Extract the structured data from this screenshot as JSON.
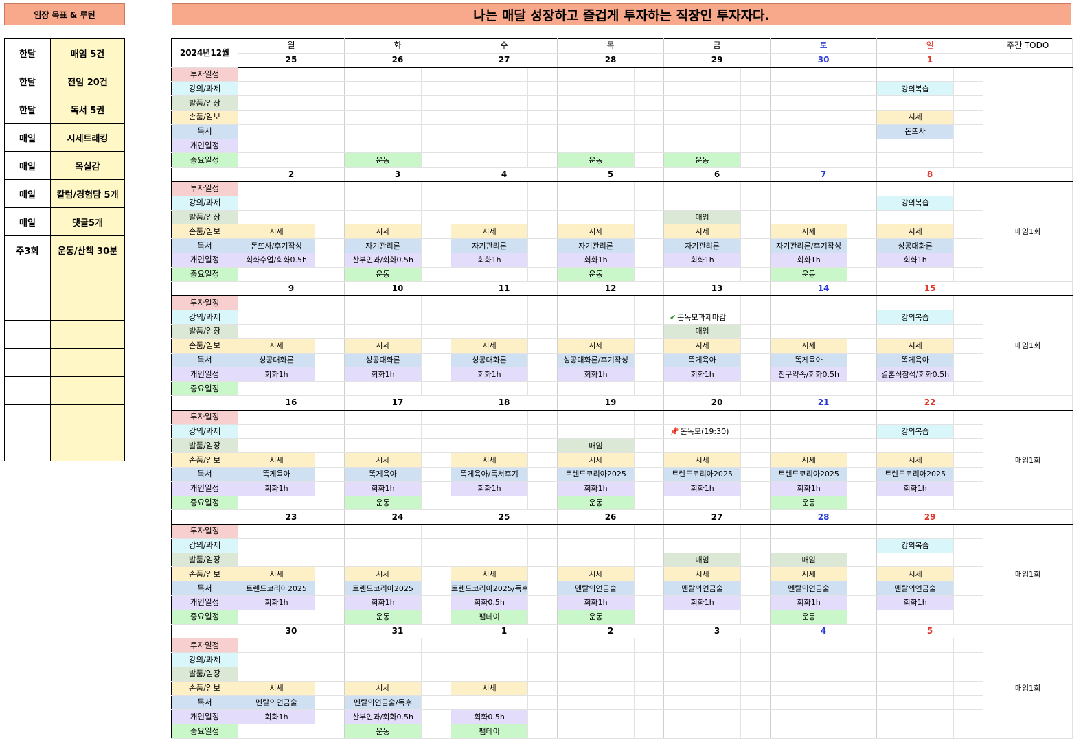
{
  "left_title": "임장 목표 & 루틴",
  "main_title": "나는 매달 성장하고 즐겁게 투자하는 직장인 투자자다.",
  "goals": [
    {
      "freq": "한달",
      "goal": "매임 5건"
    },
    {
      "freq": "한달",
      "goal": "전임 20건"
    },
    {
      "freq": "한달",
      "goal": "독서 5권"
    },
    {
      "freq": "매일",
      "goal": "시세트래킹"
    },
    {
      "freq": "매일",
      "goal": "목실감"
    },
    {
      "freq": "매일",
      "goal": "칼럼/경험담 5개"
    },
    {
      "freq": "매일",
      "goal": "댓글5개"
    },
    {
      "freq": "주3회",
      "goal": "운동/산책 30분"
    },
    {
      "freq": "",
      "goal": ""
    },
    {
      "freq": "",
      "goal": ""
    },
    {
      "freq": "",
      "goal": ""
    },
    {
      "freq": "",
      "goal": ""
    },
    {
      "freq": "",
      "goal": ""
    },
    {
      "freq": "",
      "goal": ""
    },
    {
      "freq": "",
      "goal": ""
    }
  ],
  "calendar": {
    "month_label": "2024년12월",
    "days": [
      "월",
      "화",
      "수",
      "목",
      "금",
      "토",
      "일"
    ],
    "todo_header": "주간 TODO",
    "categories": [
      "투자일정",
      "강의/과제",
      "발품/임장",
      "손품/임보",
      "독서",
      "개인일정",
      "중요일정"
    ],
    "weeks": [
      {
        "dates": [
          "25",
          "26",
          "27",
          "28",
          "29",
          "30",
          "1"
        ],
        "todo": "",
        "events": [
          [],
          [
            {
              "day": 6,
              "text": "강의복습"
            }
          ],
          [],
          [
            {
              "day": 6,
              "text": "시세"
            }
          ],
          [
            {
              "day": 6,
              "text": "돈뜨사"
            }
          ],
          [],
          [
            {
              "day": 1,
              "text": "운동"
            },
            {
              "day": 3,
              "text": "운동"
            },
            {
              "day": 4,
              "text": "운동"
            }
          ]
        ]
      },
      {
        "dates": [
          "2",
          "3",
          "4",
          "5",
          "6",
          "7",
          "8"
        ],
        "todo": "매임1회",
        "events": [
          [],
          [
            {
              "day": 6,
              "text": "강의복습"
            }
          ],
          [
            {
              "day": 4,
              "text": "매임"
            }
          ],
          [
            {
              "day": 0,
              "text": "시세"
            },
            {
              "day": 1,
              "text": "시세"
            },
            {
              "day": 2,
              "text": "시세"
            },
            {
              "day": 3,
              "text": "시세"
            },
            {
              "day": 4,
              "text": "시세"
            },
            {
              "day": 5,
              "text": "시세"
            },
            {
              "day": 6,
              "text": "시세"
            }
          ],
          [
            {
              "day": 0,
              "text": "돈뜨사/후기작성"
            },
            {
              "day": 1,
              "text": "자기관리론"
            },
            {
              "day": 2,
              "text": "자기관리론"
            },
            {
              "day": 3,
              "text": "자기관리론"
            },
            {
              "day": 4,
              "text": "자기관리론"
            },
            {
              "day": 5,
              "text": "자기관리론/후기작성"
            },
            {
              "day": 6,
              "text": "성공대화론"
            }
          ],
          [
            {
              "day": 0,
              "text": "회화수업/회화0.5h"
            },
            {
              "day": 1,
              "text": "산부인과/회화0.5h"
            },
            {
              "day": 2,
              "text": "회화1h"
            },
            {
              "day": 3,
              "text": "회화1h"
            },
            {
              "day": 4,
              "text": "회화1h"
            },
            {
              "day": 5,
              "text": "회화1h"
            },
            {
              "day": 6,
              "text": "회화1h"
            }
          ],
          [
            {
              "day": 1,
              "text": "운동"
            },
            {
              "day": 3,
              "text": "운동"
            },
            {
              "day": 5,
              "text": "운동"
            }
          ]
        ]
      },
      {
        "dates": [
          "9",
          "10",
          "11",
          "12",
          "13",
          "14",
          "15"
        ],
        "todo": "매임1회",
        "events": [
          [],
          [
            {
              "day": 4,
              "text": "돈독모과제마감",
              "icon": "check"
            },
            {
              "day": 6,
              "text": "강의복습"
            }
          ],
          [
            {
              "day": 4,
              "text": "매임"
            }
          ],
          [
            {
              "day": 0,
              "text": "시세"
            },
            {
              "day": 1,
              "text": "시세"
            },
            {
              "day": 2,
              "text": "시세"
            },
            {
              "day": 3,
              "text": "시세"
            },
            {
              "day": 4,
              "text": "시세"
            },
            {
              "day": 5,
              "text": "시세"
            },
            {
              "day": 6,
              "text": "시세"
            }
          ],
          [
            {
              "day": 0,
              "text": "성공대화론"
            },
            {
              "day": 1,
              "text": "성공대화론"
            },
            {
              "day": 2,
              "text": "성공대화론"
            },
            {
              "day": 3,
              "text": "성공대화론/후기작성"
            },
            {
              "day": 4,
              "text": "똑게육아"
            },
            {
              "day": 5,
              "text": "똑게육아"
            },
            {
              "day": 6,
              "text": "똑게육아"
            }
          ],
          [
            {
              "day": 0,
              "text": "회화1h"
            },
            {
              "day": 1,
              "text": "회화1h"
            },
            {
              "day": 2,
              "text": "회화1h"
            },
            {
              "day": 3,
              "text": "회화1h"
            },
            {
              "day": 4,
              "text": "회화1h"
            },
            {
              "day": 5,
              "text": "친구약속/회화0.5h"
            },
            {
              "day": 6,
              "text": "결혼식참석/회화0.5h"
            }
          ],
          []
        ]
      },
      {
        "dates": [
          "16",
          "17",
          "18",
          "19",
          "20",
          "21",
          "22"
        ],
        "todo": "매임1회",
        "events": [
          [],
          [
            {
              "day": 4,
              "text": "돈독모(19:30)",
              "icon": "pin"
            },
            {
              "day": 6,
              "text": "강의복습"
            }
          ],
          [
            {
              "day": 3,
              "text": "매임"
            }
          ],
          [
            {
              "day": 0,
              "text": "시세"
            },
            {
              "day": 1,
              "text": "시세"
            },
            {
              "day": 2,
              "text": "시세"
            },
            {
              "day": 3,
              "text": "시세"
            },
            {
              "day": 4,
              "text": "시세"
            },
            {
              "day": 5,
              "text": "시세"
            },
            {
              "day": 6,
              "text": "시세"
            }
          ],
          [
            {
              "day": 0,
              "text": "똑게육아"
            },
            {
              "day": 1,
              "text": "똑게육아"
            },
            {
              "day": 2,
              "text": "똑게육아/독서후기"
            },
            {
              "day": 3,
              "text": "트렌드코리아2025"
            },
            {
              "day": 4,
              "text": "트렌드코리아2025"
            },
            {
              "day": 5,
              "text": "트렌드코리아2025"
            },
            {
              "day": 6,
              "text": "트렌드코리아2025"
            }
          ],
          [
            {
              "day": 0,
              "text": "회화1h"
            },
            {
              "day": 1,
              "text": "회화1h"
            },
            {
              "day": 2,
              "text": "회화1h"
            },
            {
              "day": 3,
              "text": "회화1h"
            },
            {
              "day": 4,
              "text": "회화1h"
            },
            {
              "day": 5,
              "text": "회화1h"
            },
            {
              "day": 6,
              "text": "회화1h"
            }
          ],
          [
            {
              "day": 1,
              "text": "운동"
            },
            {
              "day": 3,
              "text": "운동"
            },
            {
              "day": 5,
              "text": "운동"
            }
          ]
        ]
      },
      {
        "dates": [
          "23",
          "24",
          "25",
          "26",
          "27",
          "28",
          "29"
        ],
        "todo": "매임1회",
        "events": [
          [],
          [
            {
              "day": 6,
              "text": "강의복습"
            }
          ],
          [
            {
              "day": 4,
              "text": "매임"
            },
            {
              "day": 5,
              "text": "매임"
            }
          ],
          [
            {
              "day": 0,
              "text": "시세"
            },
            {
              "day": 1,
              "text": "시세"
            },
            {
              "day": 2,
              "text": "시세"
            },
            {
              "day": 3,
              "text": "시세"
            },
            {
              "day": 4,
              "text": "시세"
            },
            {
              "day": 5,
              "text": "시세"
            },
            {
              "day": 6,
              "text": "시세"
            }
          ],
          [
            {
              "day": 0,
              "text": "트렌드코리아2025"
            },
            {
              "day": 1,
              "text": "트렌드코리아2025"
            },
            {
              "day": 2,
              "text": "트렌드코리아2025/독후"
            },
            {
              "day": 3,
              "text": "멘탈의연금술"
            },
            {
              "day": 4,
              "text": "멘탈의연금술"
            },
            {
              "day": 5,
              "text": "멘탈의연금술"
            },
            {
              "day": 6,
              "text": "멘탈의연금술"
            }
          ],
          [
            {
              "day": 0,
              "text": "회화1h"
            },
            {
              "day": 1,
              "text": "회화1h"
            },
            {
              "day": 2,
              "text": "회화0.5h"
            },
            {
              "day": 3,
              "text": "회화1h"
            },
            {
              "day": 4,
              "text": "회화1h"
            },
            {
              "day": 5,
              "text": "회화1h"
            },
            {
              "day": 6,
              "text": "회화1h"
            }
          ],
          [
            {
              "day": 1,
              "text": "운동"
            },
            {
              "day": 2,
              "text": "팸데이"
            },
            {
              "day": 3,
              "text": "운동"
            },
            {
              "day": 5,
              "text": "운동"
            }
          ]
        ]
      },
      {
        "dates": [
          "30",
          "31",
          "1",
          "2",
          "3",
          "4",
          "5"
        ],
        "todo": "매임1회",
        "events": [
          [],
          [],
          [],
          [
            {
              "day": 0,
              "text": "시세"
            },
            {
              "day": 1,
              "text": "시세"
            },
            {
              "day": 2,
              "text": "시세"
            }
          ],
          [
            {
              "day": 0,
              "text": "멘탈의연금술"
            },
            {
              "day": 1,
              "text": "멘탈의연금술/독후"
            }
          ],
          [
            {
              "day": 0,
              "text": "회화1h"
            },
            {
              "day": 1,
              "text": "산부인과/회화0.5h"
            },
            {
              "day": 2,
              "text": "회화0.5h"
            }
          ],
          [
            {
              "day": 1,
              "text": "운동"
            },
            {
              "day": 2,
              "text": "팸데이"
            }
          ]
        ]
      }
    ]
  },
  "colors": {
    "title_bar": "#f9a98b",
    "goal_cell": "#fff8c6",
    "saturday": "#2a3ad8",
    "sunday": "#e2342a",
    "category_backgrounds": [
      "#f8cfcf",
      "#d9f7fb",
      "#dbe8d5",
      "#fdefc6",
      "#cfe0f3",
      "#e3dcfb",
      "#c9f7c9"
    ]
  }
}
